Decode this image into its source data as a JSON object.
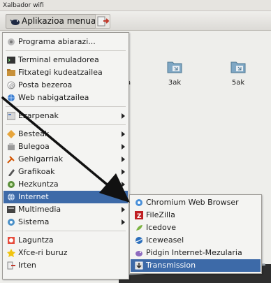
{
  "window": {
    "title": "Xalbador wifi"
  },
  "panel": {
    "app_menu_label": "Aplikazioa menua"
  },
  "desktop": {
    "icons": [
      {
        "label": "zia"
      },
      {
        "label": "3ak"
      },
      {
        "label": "5ak"
      }
    ]
  },
  "main_menu": {
    "items": [
      {
        "label": "Programa abiarazi...",
        "icon": "run-icon"
      },
      {
        "label": "Terminal emuladorea",
        "icon": "terminal-icon"
      },
      {
        "label": "Fitxategi kudeatzailea",
        "icon": "file-manager-icon"
      },
      {
        "label": "Posta bezeroa",
        "icon": "mail-icon"
      },
      {
        "label": "Web nabigatzailea",
        "icon": "web-browser-icon"
      },
      {
        "label": "Ezarpenak",
        "icon": "settings-icon"
      },
      {
        "label": "Besteak",
        "icon": "other-icon"
      },
      {
        "label": "Bulegoa",
        "icon": "office-icon"
      },
      {
        "label": "Gehigarriak",
        "icon": "accessories-icon"
      },
      {
        "label": "Grafikoak",
        "icon": "graphics-icon"
      },
      {
        "label": "Hezkuntza",
        "icon": "education-icon"
      },
      {
        "label": "Internet",
        "icon": "internet-icon"
      },
      {
        "label": "Multimedia",
        "icon": "multimedia-icon"
      },
      {
        "label": "Sistema",
        "icon": "system-icon"
      },
      {
        "label": "Laguntza",
        "icon": "help-icon"
      },
      {
        "label": "Xfce-ri buruz",
        "icon": "about-icon"
      },
      {
        "label": "Irten",
        "icon": "logout-icon"
      }
    ]
  },
  "internet_submenu": {
    "items": [
      {
        "label": "Chromium Web Browser",
        "icon": "chromium-icon"
      },
      {
        "label": "FileZilla",
        "icon": "filezilla-icon"
      },
      {
        "label": "Icedove",
        "icon": "icedove-icon"
      },
      {
        "label": "Iceweasel",
        "icon": "iceweasel-icon"
      },
      {
        "label": "Pidgin Internet-Mezularia",
        "icon": "pidgin-icon"
      },
      {
        "label": "Transmission",
        "icon": "transmission-icon"
      }
    ]
  },
  "colors": {
    "selection": "#3d6aa8",
    "menu_bg": "#f4f4f2",
    "annotation_arrow": "#111111"
  }
}
